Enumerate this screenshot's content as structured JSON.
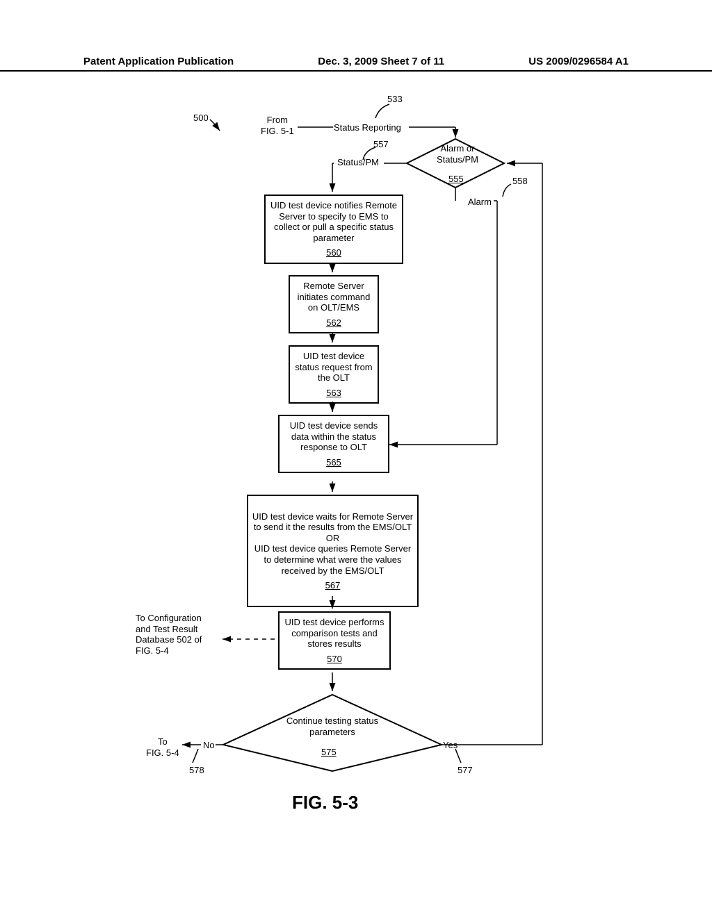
{
  "header": {
    "left": "Patent Application Publication",
    "center": "Dec. 3, 2009  Sheet 7 of 11",
    "right": "US 2009/0296584 A1"
  },
  "labels": {
    "ref500": "500",
    "fromFig": "From\nFIG. 5-1",
    "statusReporting": "Status Reporting",
    "ref533": "533",
    "ref557": "557",
    "statusPM": "Status/PM",
    "decision555_text": "Alarm or\nStatus/PM",
    "decision555_ref": "555",
    "ref558": "558",
    "alarm": "Alarm",
    "toConfig": "To Configuration\nand Test Result\nDatabase 502 of\nFIG. 5-4",
    "toFig54": "To\nFIG. 5-4",
    "no": "No",
    "yes": "Yes",
    "ref577": "577",
    "ref578": "578",
    "fig": "FIG. 5-3"
  },
  "boxes": {
    "b560_text": "UID test device notifies Remote Server to specify to EMS to collect or pull a specific status parameter",
    "b560_ref": "560",
    "b562_text": "Remote Server initiates command on OLT/EMS",
    "b562_ref": "562",
    "b563_text": "UID test device status request from the OLT",
    "b563_ref": "563",
    "b565_text": "UID test device sends data within the status response to OLT",
    "b565_ref": "565",
    "b567_text": "UID test device waits for Remote Server to send it the results from the EMS/OLT\nOR\nUID test device queries Remote Server to determine what were the values received by the EMS/OLT",
    "b567_ref": "567",
    "b570_text": "UID test device performs comparison tests and stores results",
    "b570_ref": "570",
    "d575_text": "Continue testing status parameters",
    "d575_ref": "575"
  }
}
